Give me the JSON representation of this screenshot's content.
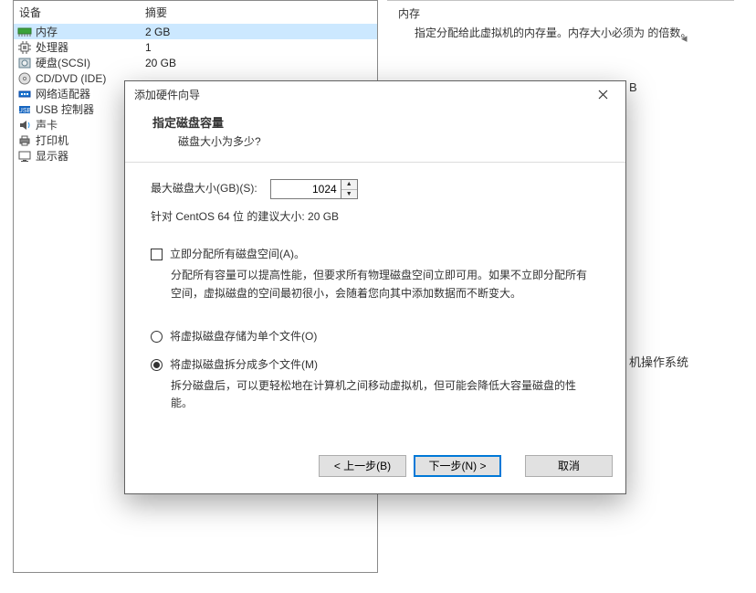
{
  "hardware_table": {
    "headers": {
      "device": "设备",
      "summary": "摘要"
    },
    "rows": [
      {
        "name": "内存",
        "summary": "2 GB",
        "icon": "memory-icon",
        "selected": true
      },
      {
        "name": "处理器",
        "summary": "1",
        "icon": "cpu-icon",
        "selected": false
      },
      {
        "name": "硬盘(SCSI)",
        "summary": "20 GB",
        "icon": "disk-icon",
        "selected": false
      },
      {
        "name": "CD/DVD (IDE)",
        "summary": "",
        "icon": "cd-icon",
        "selected": false
      },
      {
        "name": "网络适配器",
        "summary": "",
        "icon": "network-icon",
        "selected": false
      },
      {
        "name": "USB 控制器",
        "summary": "",
        "icon": "usb-icon",
        "selected": false
      },
      {
        "name": "声卡",
        "summary": "",
        "icon": "sound-icon",
        "selected": false
      },
      {
        "name": "打印机",
        "summary": "",
        "icon": "printer-icon",
        "selected": false
      },
      {
        "name": "显示器",
        "summary": "",
        "icon": "display-icon",
        "selected": false
      }
    ]
  },
  "memory_panel": {
    "title": "内存",
    "body": "指定分配给此虚拟机的内存量。内存大小必须为 的倍数。"
  },
  "side_clipped": {
    "b_text": "B",
    "os_text": "机操作系统",
    "arrow": "◂"
  },
  "dialog": {
    "title": "添加硬件向导",
    "heading": "指定磁盘容量",
    "subheading": "磁盘大小为多少?",
    "max_size_label": "最大磁盘大小(GB)(S):",
    "max_size_value": "1024",
    "recommend": "针对 CentOS 64 位 的建议大小: 20 GB",
    "allocate_now_label": "立即分配所有磁盘空间(A)。",
    "allocate_now_desc": "分配所有容量可以提高性能，但要求所有物理磁盘空间立即可用。如果不立即分配所有空间，虚拟磁盘的空间最初很小，会随着您向其中添加数据而不断变大。",
    "radio_single_label": "将虚拟磁盘存储为单个文件(O)",
    "radio_split_label": "将虚拟磁盘拆分成多个文件(M)",
    "radio_split_desc": "拆分磁盘后，可以更轻松地在计算机之间移动虚拟机，但可能会降低大容量磁盘的性能。",
    "buttons": {
      "back": "< 上一步(B)",
      "next": "下一步(N) >",
      "cancel": "取消"
    }
  }
}
